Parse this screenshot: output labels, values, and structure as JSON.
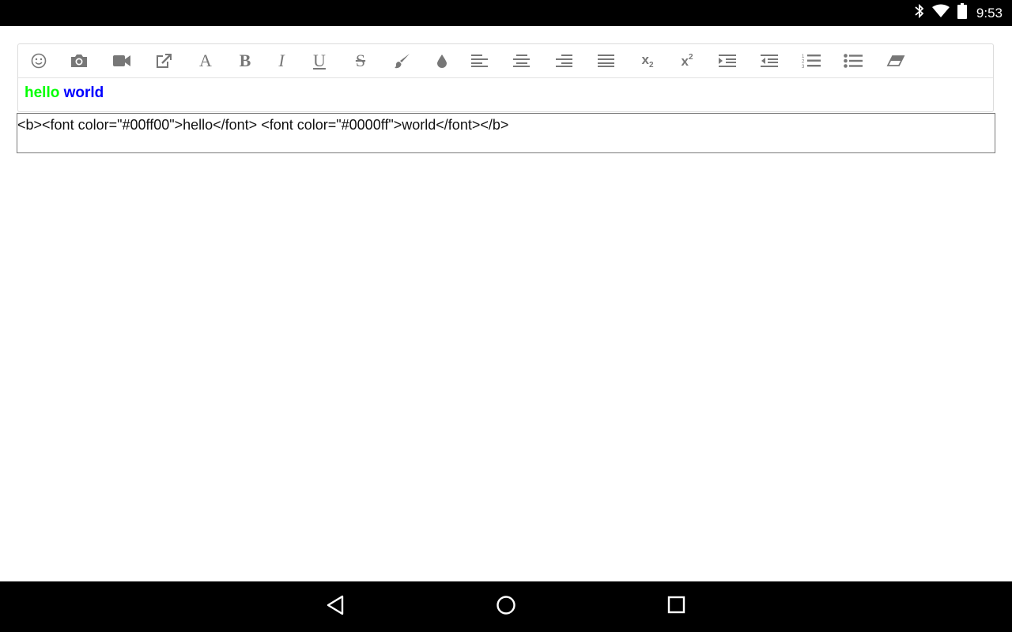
{
  "status_bar": {
    "time": "9:53",
    "icons": [
      "bluetooth-icon",
      "wifi-icon",
      "battery-icon"
    ]
  },
  "toolbar": {
    "buttons": [
      {
        "name": "emoji",
        "icon": "smile-icon"
      },
      {
        "name": "insert-image",
        "icon": "camera-icon"
      },
      {
        "name": "insert-video",
        "icon": "video-camera-icon"
      },
      {
        "name": "insert-link",
        "icon": "external-link-icon"
      },
      {
        "name": "font",
        "icon": "font-icon",
        "glyph": "A"
      },
      {
        "name": "bold",
        "icon": "bold-icon",
        "glyph": "B"
      },
      {
        "name": "italic",
        "icon": "italic-icon",
        "glyph": "I"
      },
      {
        "name": "underline",
        "icon": "underline-icon",
        "glyph": "U"
      },
      {
        "name": "strikethrough",
        "icon": "strikethrough-icon",
        "glyph": "S"
      },
      {
        "name": "text-color",
        "icon": "paintbrush-icon"
      },
      {
        "name": "background-color",
        "icon": "droplet-icon"
      },
      {
        "name": "align-left",
        "icon": "align-left-icon"
      },
      {
        "name": "align-center",
        "icon": "align-center-icon"
      },
      {
        "name": "align-right",
        "icon": "align-right-icon"
      },
      {
        "name": "align-justify",
        "icon": "align-justify-icon"
      },
      {
        "name": "subscript",
        "icon": "subscript-icon",
        "glyph": "x",
        "small": "2"
      },
      {
        "name": "superscript",
        "icon": "superscript-icon",
        "glyph": "x",
        "small": "2"
      },
      {
        "name": "indent",
        "icon": "indent-icon"
      },
      {
        "name": "outdent",
        "icon": "outdent-icon"
      },
      {
        "name": "ordered-list",
        "icon": "ordered-list-icon"
      },
      {
        "name": "unordered-list",
        "icon": "unordered-list-icon"
      },
      {
        "name": "clear-format",
        "icon": "eraser-icon"
      }
    ]
  },
  "editor": {
    "words": [
      {
        "text": "hello",
        "color": "#00ff00"
      },
      {
        "text": " ",
        "color": "#000000"
      },
      {
        "text": "world",
        "color": "#0000ff"
      }
    ],
    "html_source": "<b><font color=\"#00ff00\">hello</font> <font color=\"#0000ff\">world</font></b>"
  },
  "navigation_bar": {
    "buttons": [
      "back-icon",
      "home-icon",
      "recents-icon"
    ]
  }
}
